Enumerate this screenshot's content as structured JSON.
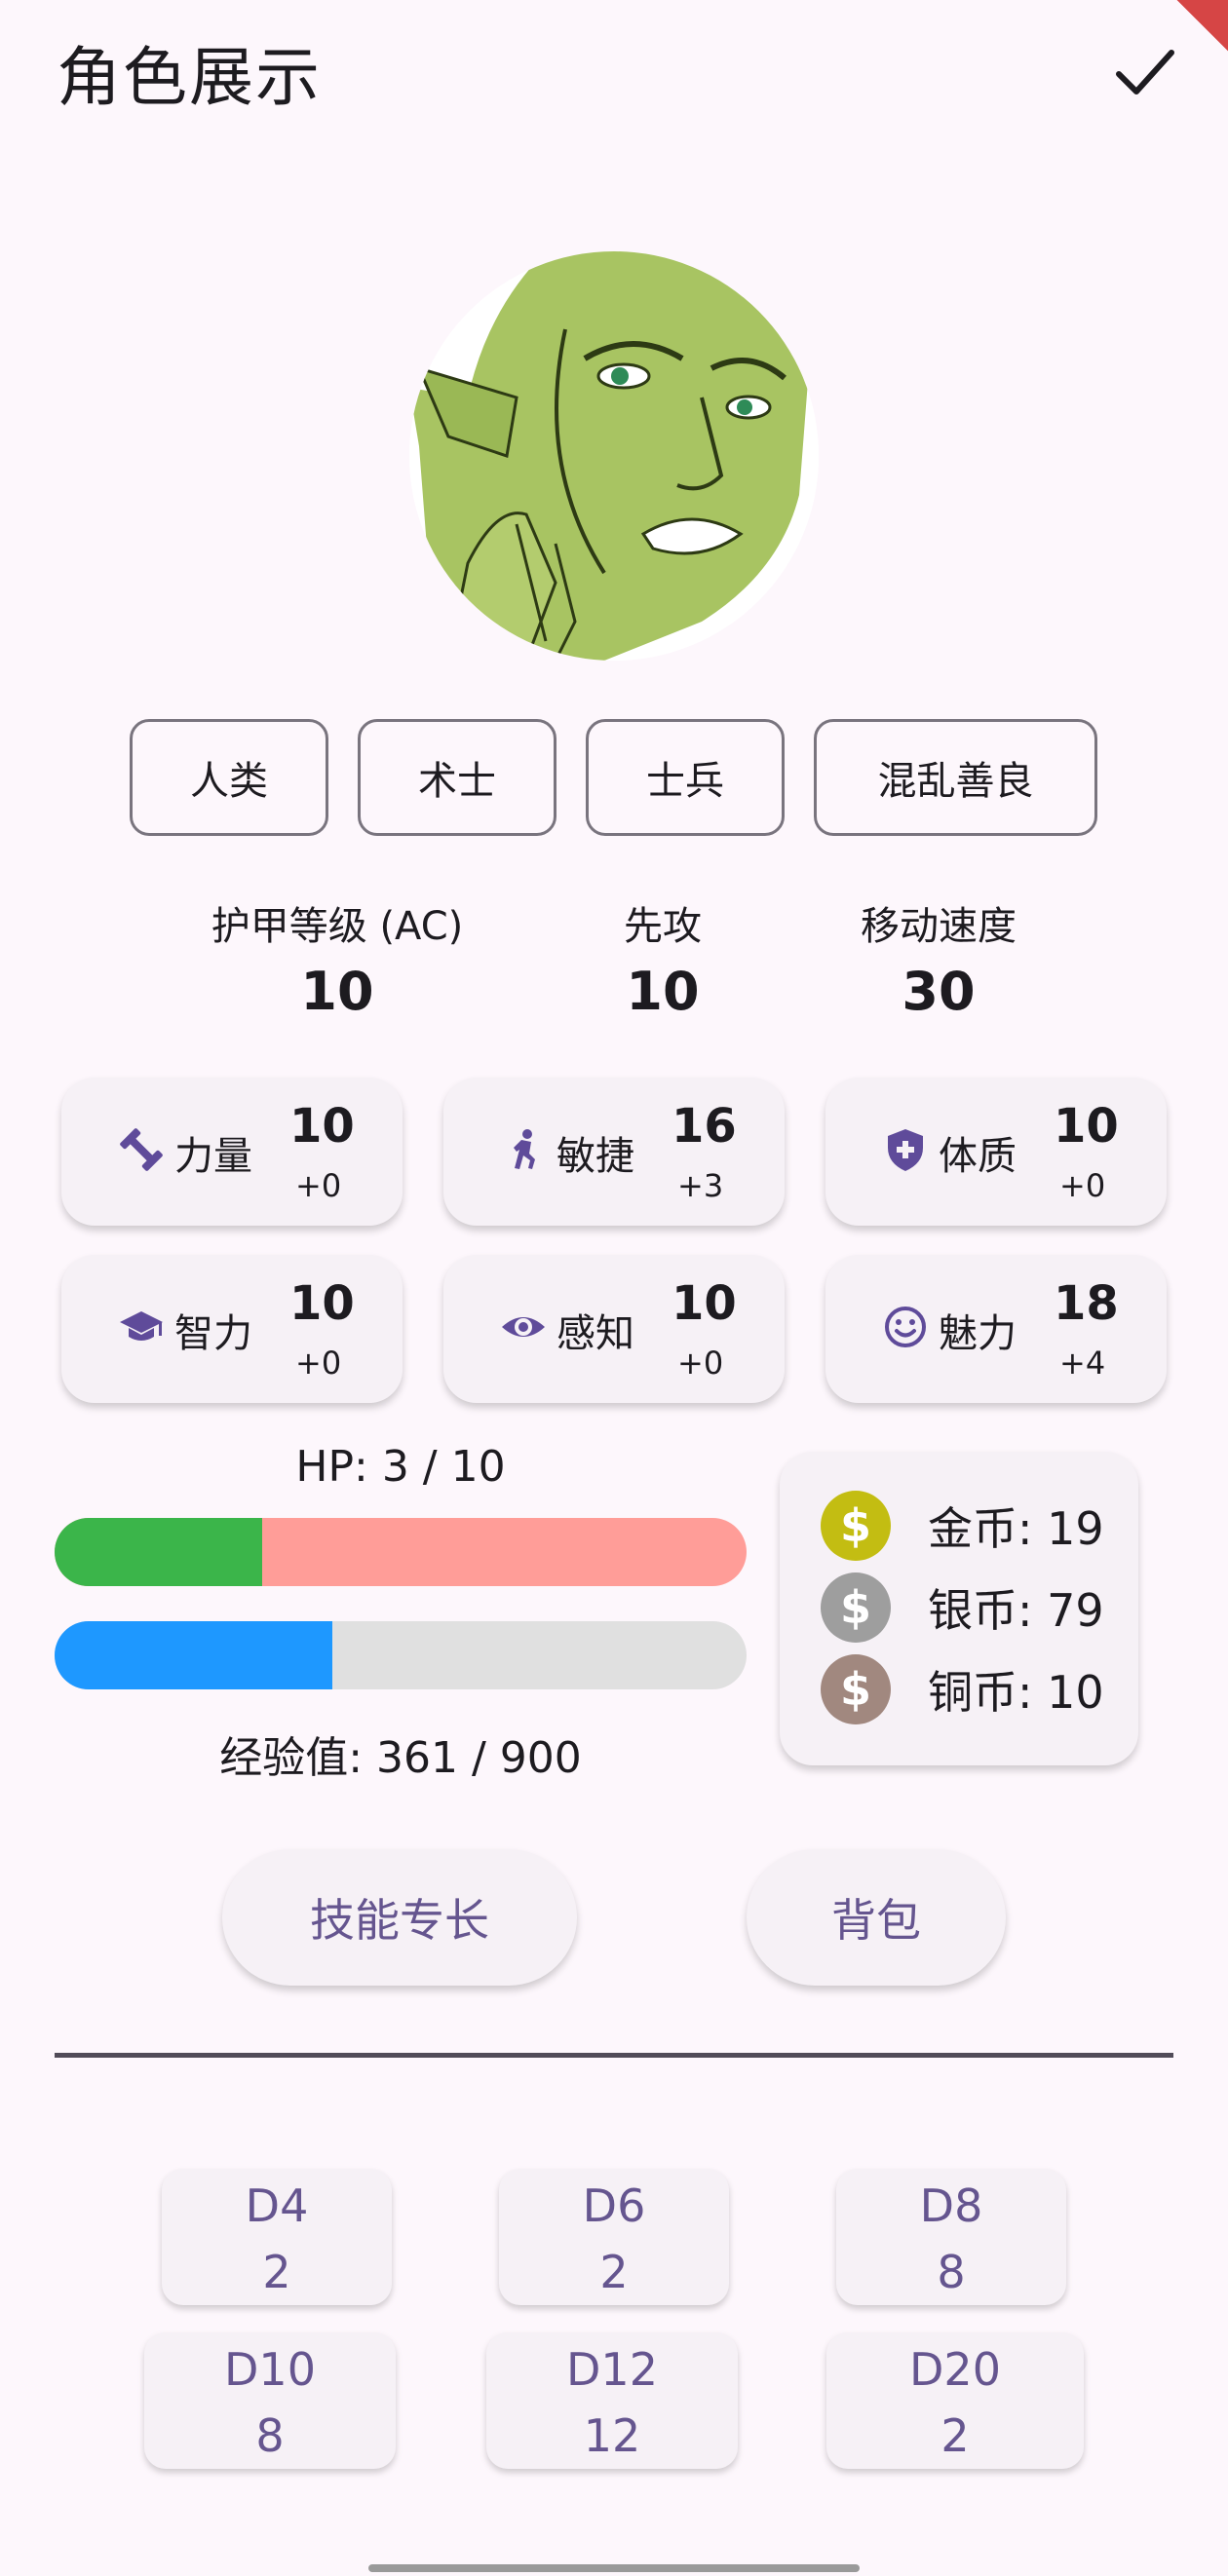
{
  "header": {
    "title": "角色展示"
  },
  "tags": [
    "人类",
    "术士",
    "士兵",
    "混乱善良"
  ],
  "combat": [
    {
      "label": "护甲等级 (AC)",
      "value": "10"
    },
    {
      "label": "先攻",
      "value": "10"
    },
    {
      "label": "移动速度",
      "value": "30"
    }
  ],
  "abilities": [
    {
      "icon": "dumbbell-icon",
      "name": "力量",
      "score": "10",
      "mod": "+0"
    },
    {
      "icon": "running-person-icon",
      "name": "敏捷",
      "score": "16",
      "mod": "+3"
    },
    {
      "icon": "shield-plus-icon",
      "name": "体质",
      "score": "10",
      "mod": "+0"
    },
    {
      "icon": "graduation-cap-icon",
      "name": "智力",
      "score": "10",
      "mod": "+0"
    },
    {
      "icon": "eye-icon",
      "name": "感知",
      "score": "10",
      "mod": "+0"
    },
    {
      "icon": "smiley-icon",
      "name": "魅力",
      "score": "18",
      "mod": "+4"
    }
  ],
  "hp": {
    "label": "HP: 3 / 10",
    "fraction": 0.3,
    "fill_color": "#3bb54a",
    "track_color": "#ff9d98"
  },
  "xp": {
    "label": "经验值: 361 / 900",
    "fraction": 0.401,
    "fill_color": "#1e98ff",
    "track_color": "#e0e0e0"
  },
  "coins": [
    {
      "icon": "dollar-coin-icon",
      "label": "金币: 19",
      "color": "#c3bd12"
    },
    {
      "icon": "dollar-coin-icon",
      "label": "银币: 79",
      "color": "#9e9e9e"
    },
    {
      "icon": "dollar-coin-icon",
      "label": "铜币: 10",
      "color": "#a1887f"
    }
  ],
  "buttons": {
    "skills": "技能专长",
    "bag": "背包"
  },
  "dice": [
    {
      "name": "D4",
      "count": "2"
    },
    {
      "name": "D6",
      "count": "2"
    },
    {
      "name": "D8",
      "count": "8"
    },
    {
      "name": "D10",
      "count": "8"
    },
    {
      "name": "D12",
      "count": "12"
    },
    {
      "name": "D20",
      "count": "2"
    }
  ],
  "colors": {
    "accent": "#65558f",
    "icon": "#5f4b9a"
  }
}
